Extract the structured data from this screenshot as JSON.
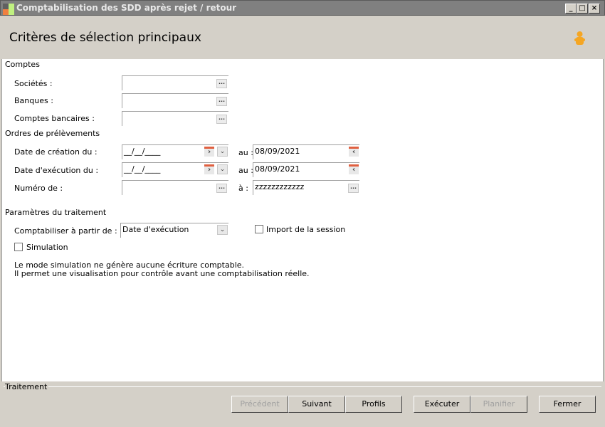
{
  "window": {
    "title": "Comptabilisation des SDD après rejet / retour",
    "minimize": "_",
    "maximize": "□",
    "close": "×"
  },
  "header": {
    "title": "Critères de sélection principaux",
    "user_icon": "user-icon"
  },
  "comptes": {
    "section": "Comptes",
    "societes": "Sociétés :",
    "banques": "Banques :",
    "comptes_bancaires": "Comptes bancaires :",
    "browse": "..."
  },
  "ordres": {
    "section": "Ordres de prélèvements",
    "date_creation": "Date de création du :",
    "date_execution": "Date d'exécution du :",
    "numero": "Numéro de :",
    "date_placeholder": "__/__/____",
    "au": "au :",
    "a": "à :",
    "date_creation_to": "08/09/2021",
    "date_execution_to": "08/09/2021",
    "numero_to": "zzzzzzzzzzzz"
  },
  "parametres": {
    "section": "Paramètres du traitement",
    "comptabiliser_label": "Comptabiliser à partir de :",
    "comptabiliser_value": "Date d'exécution",
    "import_session": "Import de la session",
    "simulation": "Simulation",
    "info1": "Le mode simulation ne génère aucune écriture comptable.",
    "info2": "Il permet une visualisation pour contrôle avant une comptabilisation réelle."
  },
  "footer": {
    "section": "Traitement",
    "precedent": "Précédent",
    "suivant": "Suivant",
    "profils": "Profils",
    "executer": "Exécuter",
    "planifier": "Planifier",
    "fermer": "Fermer"
  },
  "colors": {
    "titlebar": "#808080",
    "background": "#d4d0c8",
    "accent": "#f5a623"
  }
}
